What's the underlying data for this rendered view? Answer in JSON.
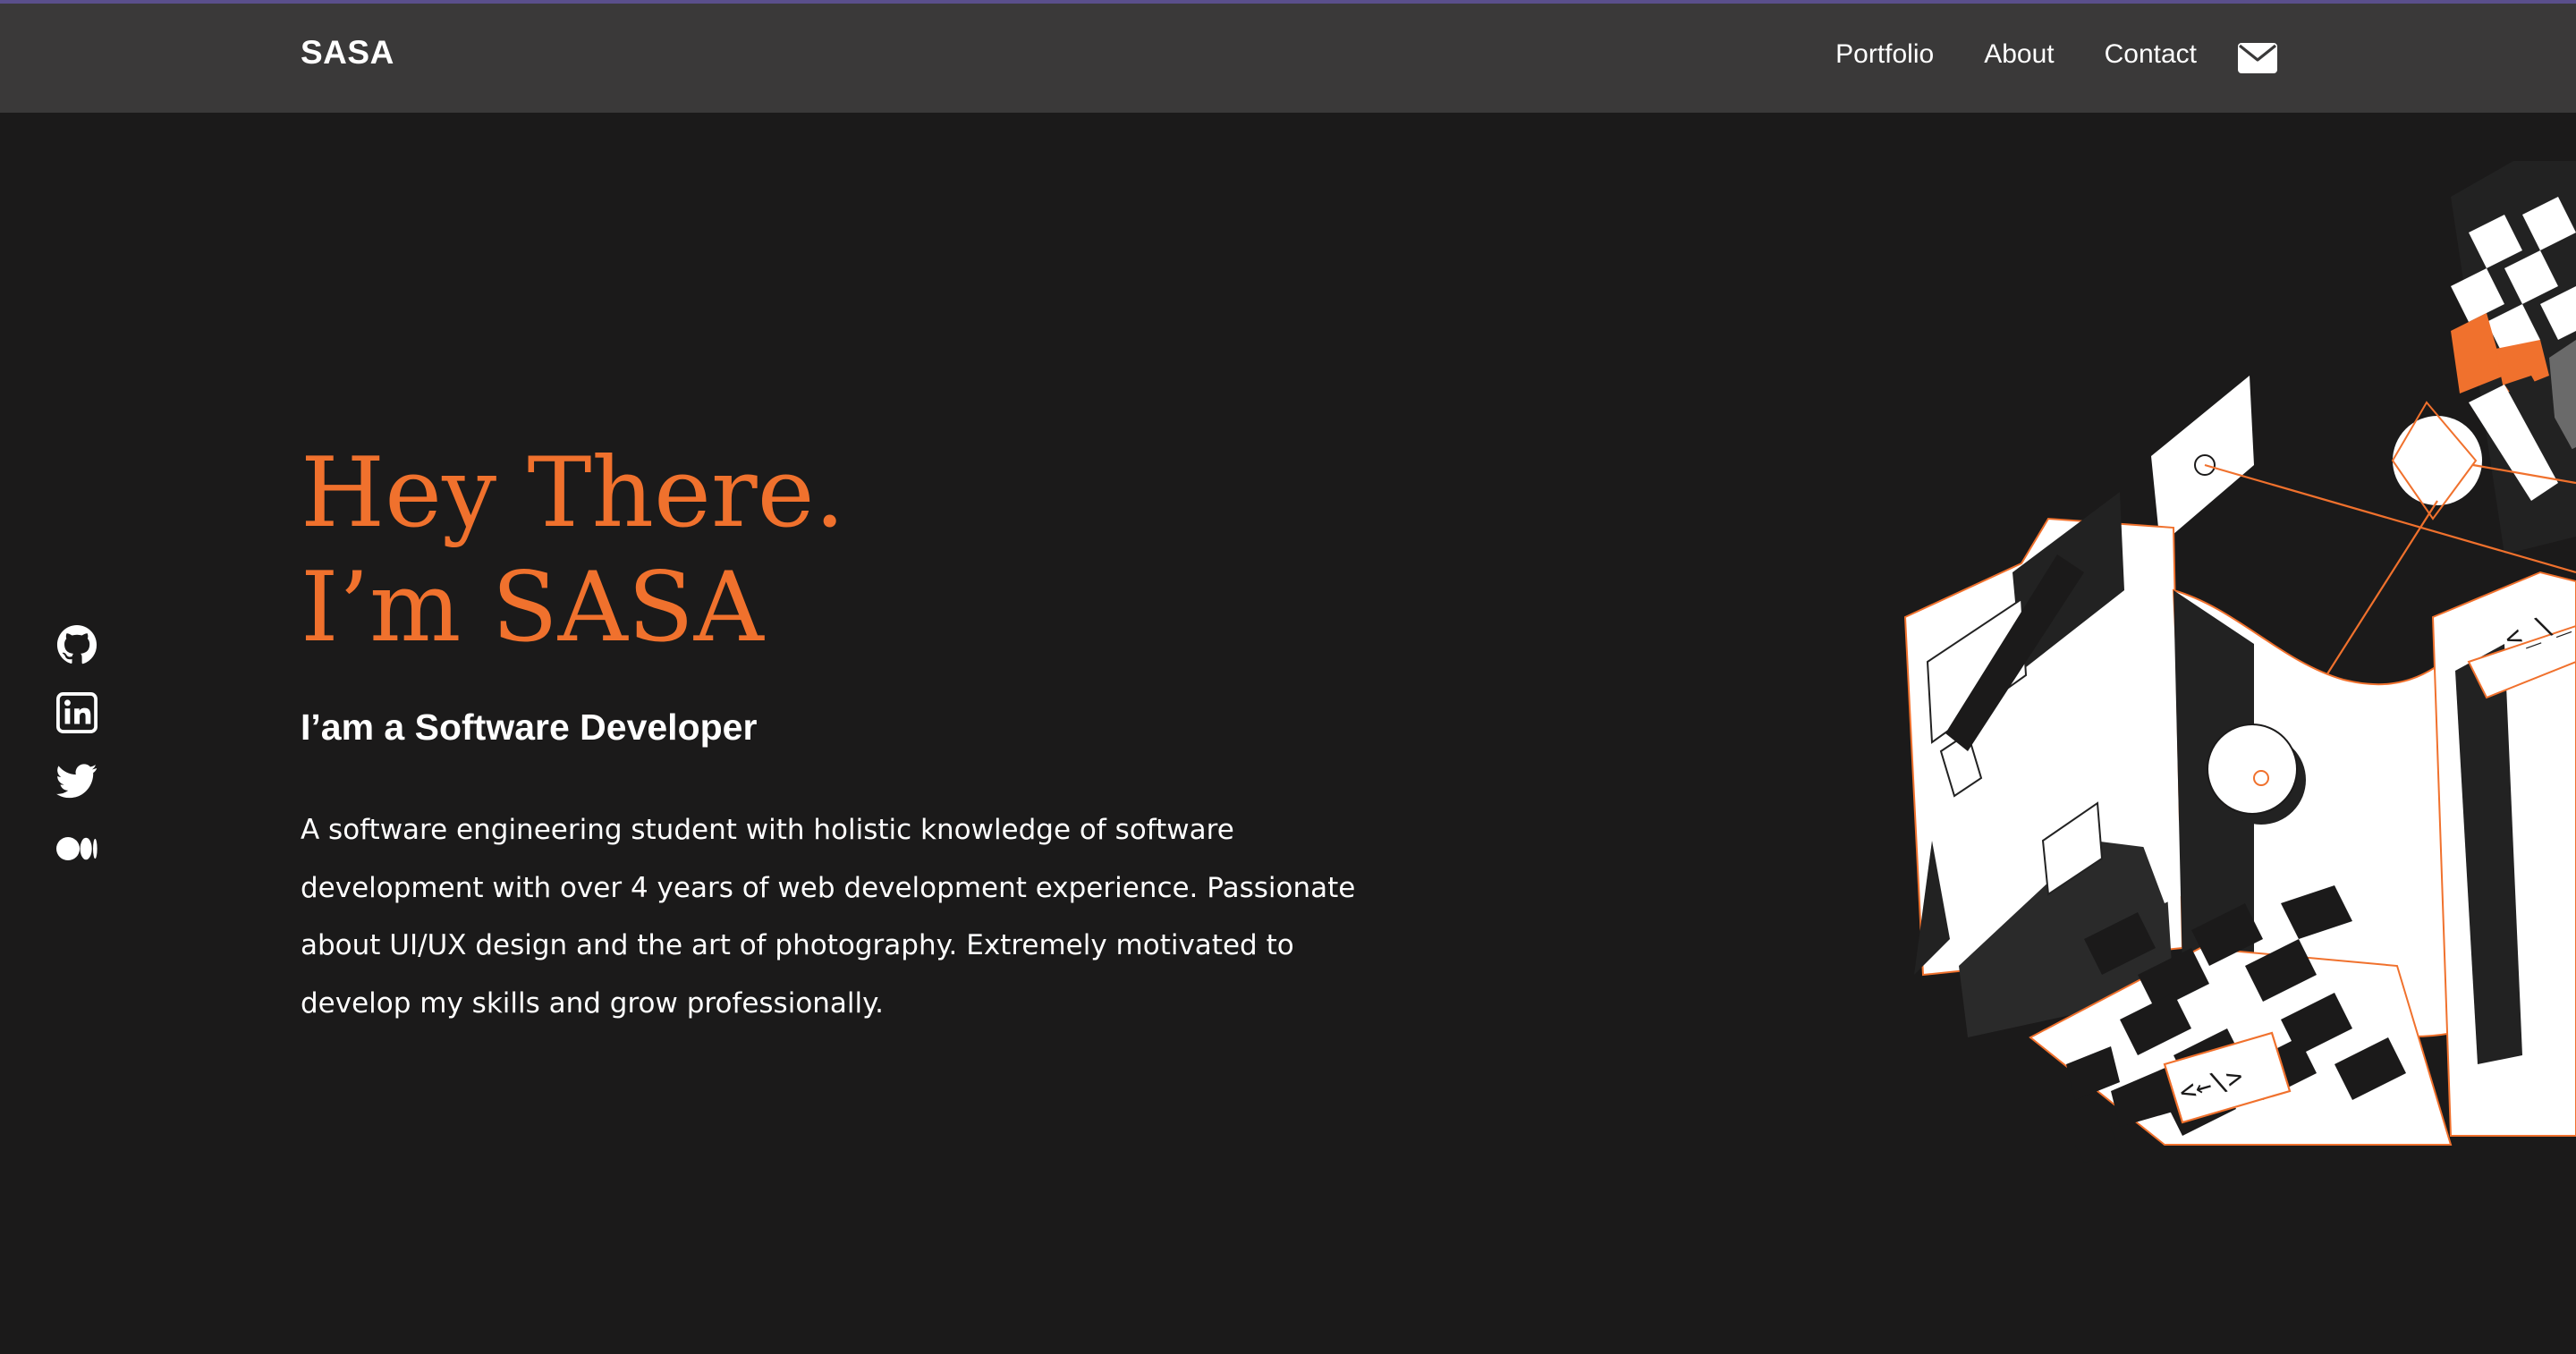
{
  "header": {
    "brand": "SASA",
    "nav": [
      {
        "label": "Portfolio"
      },
      {
        "label": "About"
      },
      {
        "label": "Contact"
      }
    ],
    "mail_icon": "envelope-icon"
  },
  "social": [
    {
      "icon": "github-icon"
    },
    {
      "icon": "linkedin-icon"
    },
    {
      "icon": "twitter-icon"
    },
    {
      "icon": "medium-icon"
    }
  ],
  "hero": {
    "title_line1": "Hey There.",
    "title_line2": "I’m SASA",
    "subtitle": "I’am a Software Developer",
    "bio": "A software engineering student with holistic knowledge of software development with over 4 years of web development experience. Passionate about UI/UX design and the art of photography. Extremely motivated to develop my skills and grow professionally."
  },
  "illustration": {
    "code_tag_1": "<_\\_",
    "code_tag_2": "<←\\>"
  },
  "colors": {
    "background": "#1b1a1a",
    "navbar": "#3a3939",
    "accent": "#f0712d",
    "text": "#ffffff",
    "topline": "#5a4f8c"
  }
}
